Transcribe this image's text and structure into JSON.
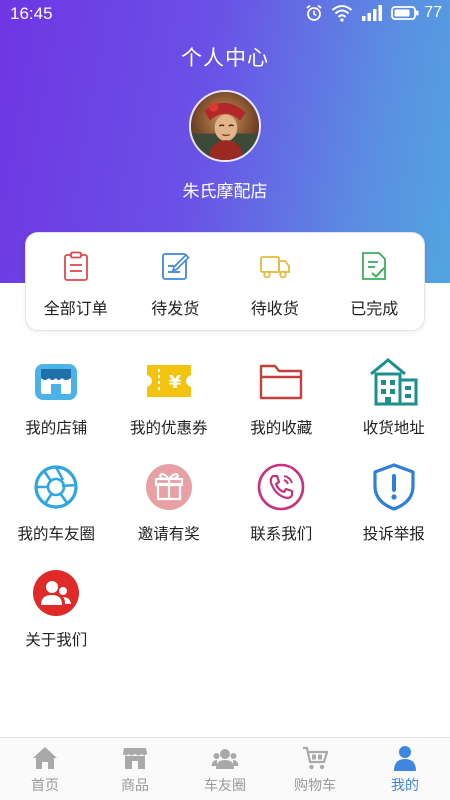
{
  "status_bar": {
    "time": "16:45",
    "battery": "77"
  },
  "header": {
    "title": "个人中心",
    "store_name": "朱氏摩配店"
  },
  "orders": [
    {
      "label": "全部订单",
      "icon": "clipboard-icon",
      "color": "#e0484f"
    },
    {
      "label": "待发货",
      "icon": "edit-note-icon",
      "color": "#3f86e0"
    },
    {
      "label": "待收货",
      "icon": "truck-icon",
      "color": "#e8b93a"
    },
    {
      "label": "已完成",
      "icon": "checklist-icon",
      "color": "#3cae5a"
    }
  ],
  "services": [
    {
      "label": "我的店铺",
      "icon": "shop-icon"
    },
    {
      "label": "我的优惠券",
      "icon": "coupon-icon"
    },
    {
      "label": "我的收藏",
      "icon": "folder-icon"
    },
    {
      "label": "收货地址",
      "icon": "building-icon"
    },
    {
      "label": "我的车友圈",
      "icon": "camera-aperture-icon"
    },
    {
      "label": "邀请有奖",
      "icon": "gift-icon"
    },
    {
      "label": "联系我们",
      "icon": "phone-icon"
    },
    {
      "label": "投诉举报",
      "icon": "shield-alert-icon"
    },
    {
      "label": "关于我们",
      "icon": "people-icon"
    }
  ],
  "tabs": [
    {
      "label": "首页",
      "icon": "home-icon"
    },
    {
      "label": "商品",
      "icon": "store-icon"
    },
    {
      "label": "车友圈",
      "icon": "group-icon"
    },
    {
      "label": "购物车",
      "icon": "cart-icon"
    },
    {
      "label": "我的",
      "icon": "user-icon",
      "active": true
    }
  ],
  "colors": {
    "header_gradient_start": "#6f35e3",
    "header_gradient_end": "#52a5e0",
    "active_tab": "#3f86e0",
    "inactive_tab": "#9a9a9a"
  }
}
